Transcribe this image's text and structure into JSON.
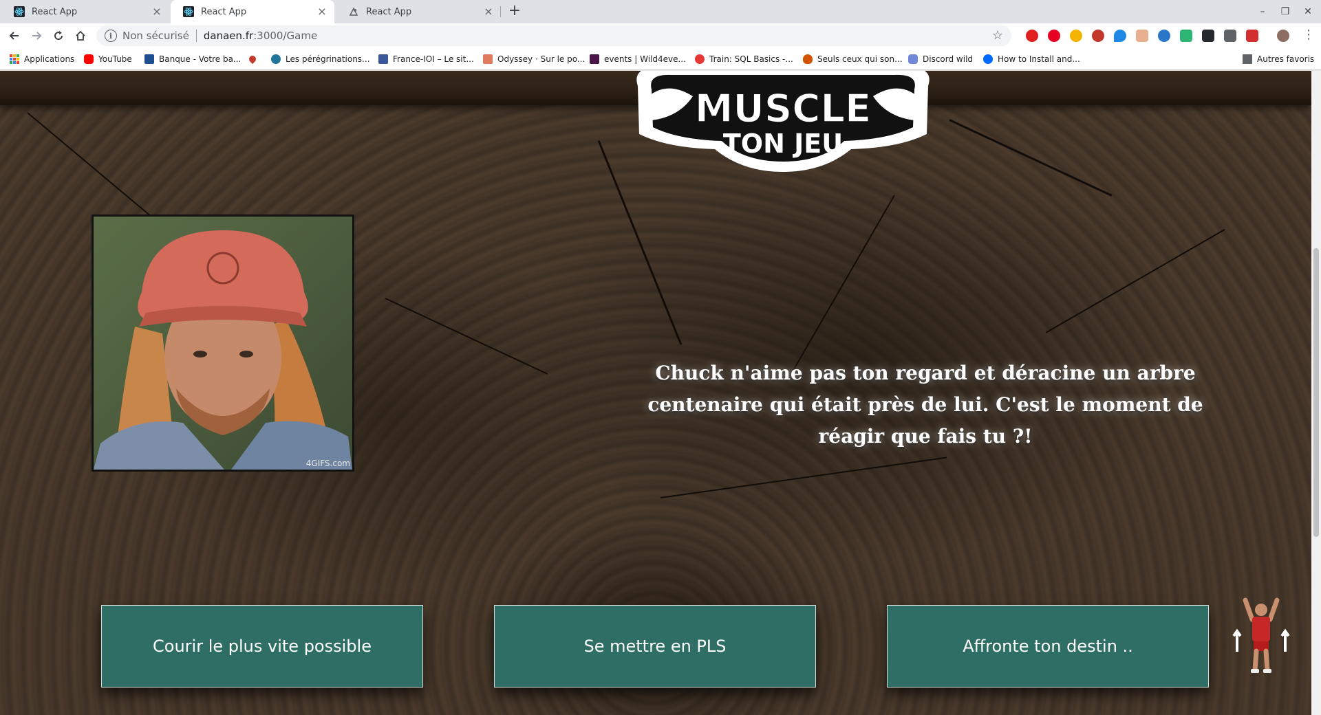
{
  "tabs": [
    {
      "title": "React App",
      "active": false
    },
    {
      "title": "React App",
      "active": true
    },
    {
      "title": "React App",
      "active": false
    }
  ],
  "toolbar": {
    "security_label": "Non sécurisé",
    "url_host": "danaen.fr",
    "url_path": ":3000/Game"
  },
  "bookmarks": {
    "items": [
      {
        "label": "Applications",
        "icon": "apps-grid-icon",
        "color": "#4285f4"
      },
      {
        "label": "YouTube",
        "icon": "youtube-icon",
        "color": "#ff0000"
      },
      {
        "label": "Banque - Votre ba...",
        "icon": "bank-icon",
        "color": "#1d4f91"
      },
      {
        "label": "",
        "icon": "heart-icon",
        "color": "#c0392b"
      },
      {
        "label": "Les pérégrinations...",
        "icon": "wordpress-icon",
        "color": "#21759b"
      },
      {
        "label": "France-IOI – Le sit...",
        "icon": "france-ioi-icon",
        "color": "#3b5998"
      },
      {
        "label": "Odyssey · Sur le po...",
        "icon": "odyssey-icon",
        "color": "#e07a5f"
      },
      {
        "label": "events | Wild4eve...",
        "icon": "slack-icon",
        "color": "#4a154b"
      },
      {
        "label": "Train: SQL Basics -...",
        "icon": "vertabelo-icon",
        "color": "#e53935"
      },
      {
        "label": "Seuls ceux qui son...",
        "icon": "acorn-icon",
        "color": "#d35400"
      },
      {
        "label": "Discord wild",
        "icon": "discord-icon",
        "color": "#7289da"
      },
      {
        "label": "How to Install and...",
        "icon": "digitalocean-icon",
        "color": "#0069ff"
      }
    ],
    "other_label": "Autres favoris"
  },
  "game": {
    "logo_line1": "MUSCLE",
    "logo_line2": "TON JEU",
    "gif_credit": "4GIFS.com",
    "story": "Chuck n'aime pas ton regard et déracine un arbre centenaire qui était près de lui. C'est le moment de réagir que fais tu ?!",
    "choices": [
      {
        "label": "Courir le plus vite possible"
      },
      {
        "label": "Se mettre en PLS"
      },
      {
        "label": "Affronte ton destin .."
      }
    ],
    "accent_color": "#2e6e64"
  }
}
